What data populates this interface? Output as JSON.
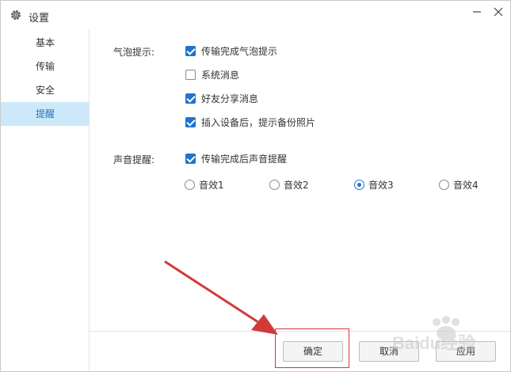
{
  "window": {
    "title": "设置"
  },
  "sidebar": {
    "items": [
      {
        "label": "基本"
      },
      {
        "label": "传输"
      },
      {
        "label": "安全"
      },
      {
        "label": "提醒"
      }
    ]
  },
  "bubble": {
    "label": "气泡提示:",
    "options": [
      {
        "label": "传输完成气泡提示",
        "checked": true
      },
      {
        "label": "系统消息",
        "checked": false
      },
      {
        "label": "好友分享消息",
        "checked": true
      },
      {
        "label": "插入设备后，提示备份照片",
        "checked": true
      }
    ]
  },
  "sound": {
    "label": "声音提醒:",
    "checkbox": {
      "label": "传输完成后声音提醒",
      "checked": true
    },
    "effects": [
      {
        "label": "音效1",
        "selected": false
      },
      {
        "label": "音效2",
        "selected": false
      },
      {
        "label": "音效3",
        "selected": true
      },
      {
        "label": "音效4",
        "selected": false
      }
    ]
  },
  "footer": {
    "ok": "确定",
    "cancel": "取消",
    "apply": "应用"
  },
  "watermark": {
    "text": "Baidu经验"
  },
  "colors": {
    "accent": "#1f74cc",
    "active_bg": "#cde8f8",
    "annotation": "#d23a3a"
  }
}
